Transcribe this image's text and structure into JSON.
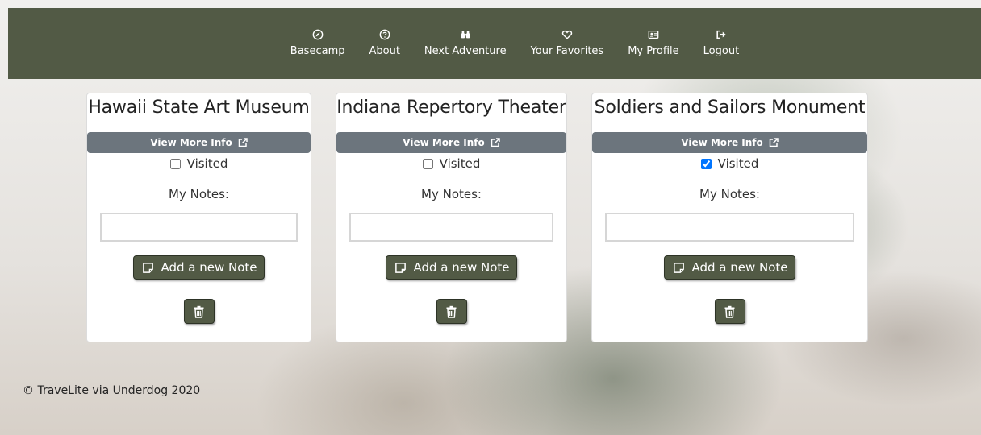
{
  "nav": {
    "items": [
      {
        "label": "Basecamp",
        "icon": "compass-icon"
      },
      {
        "label": "About",
        "icon": "question-circle-icon"
      },
      {
        "label": "Next Adventure",
        "icon": "binoculars-icon"
      },
      {
        "label": "Your Favorites",
        "icon": "heart-icon"
      },
      {
        "label": "My Profile",
        "icon": "id-card-icon"
      },
      {
        "label": "Logout",
        "icon": "sign-out-icon"
      }
    ]
  },
  "cards": [
    {
      "title": "Hawaii State Art Museum",
      "info_label": "View More Info",
      "visited_label": "Visited",
      "visited": false,
      "notes_label": "My Notes:",
      "note_value": "",
      "add_label": "Add a new Note"
    },
    {
      "title": "Indiana Repertory Theater",
      "info_label": "View More Info",
      "visited_label": "Visited",
      "visited": false,
      "notes_label": "My Notes:",
      "note_value": "",
      "add_label": "Add a new Note"
    },
    {
      "title": "Soldiers and Sailors Monument",
      "info_label": "View More Info",
      "visited_label": "Visited",
      "visited": true,
      "notes_label": "My Notes:",
      "note_value": "",
      "add_label": "Add a new Note"
    }
  ],
  "footer": {
    "text": "© TraveLite via Underdog 2020"
  },
  "colors": {
    "navbar": "#525a45",
    "info_button": "#6c757d",
    "action_button": "#525a45"
  }
}
